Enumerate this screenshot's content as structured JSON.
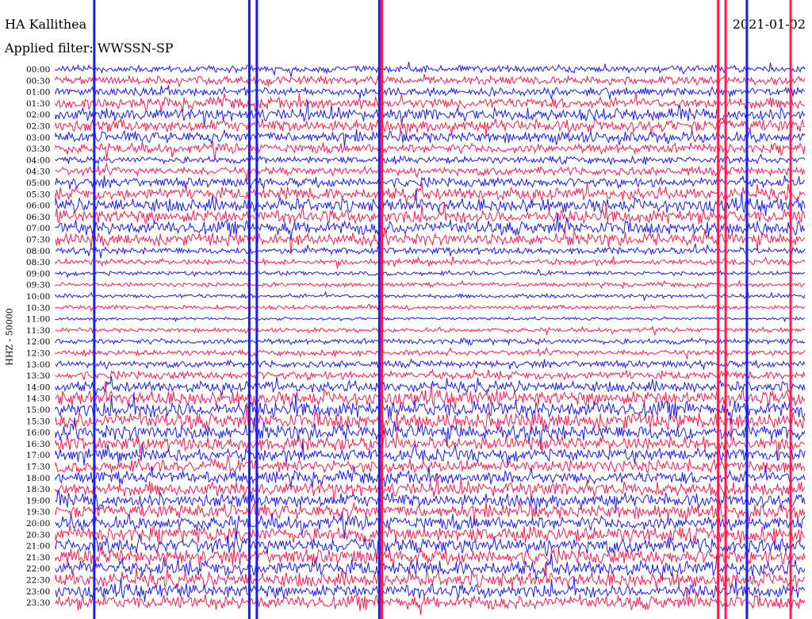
{
  "header": {
    "station": "HA Kallithea",
    "filter_label": "Applied filter: WWSSN-SP",
    "date": "2021-01-02"
  },
  "axis": {
    "ylabel": "HHZ - 50000"
  },
  "chart_data": {
    "type": "line",
    "title": "HA Kallithea",
    "subtitle": "Applied filter: WWSSN-SP",
    "date": "2021-01-02",
    "ylabel": "HHZ - 50000",
    "trace_colors": [
      "#1a1aff",
      "#ff1a4d"
    ],
    "x": {
      "unit": "minutes",
      "range": [
        0,
        30
      ]
    },
    "rows": [
      {
        "label": "00:00",
        "amp": 5
      },
      {
        "label": "00:30",
        "amp": 6
      },
      {
        "label": "01:00",
        "amp": 6
      },
      {
        "label": "01:30",
        "amp": 8
      },
      {
        "label": "02:00",
        "amp": 9
      },
      {
        "label": "02:30",
        "amp": 9
      },
      {
        "label": "03:00",
        "amp": 8
      },
      {
        "label": "03:30",
        "amp": 7
      },
      {
        "label": "04:00",
        "amp": 5
      },
      {
        "label": "04:30",
        "amp": 6
      },
      {
        "label": "05:00",
        "amp": 7
      },
      {
        "label": "05:30",
        "amp": 9
      },
      {
        "label": "06:00",
        "amp": 10
      },
      {
        "label": "06:30",
        "amp": 10
      },
      {
        "label": "07:00",
        "amp": 10
      },
      {
        "label": "07:30",
        "amp": 9
      },
      {
        "label": "08:00",
        "amp": 5
      },
      {
        "label": "08:30",
        "amp": 4
      },
      {
        "label": "09:00",
        "amp": 3
      },
      {
        "label": "09:30",
        "amp": 3
      },
      {
        "label": "10:00",
        "amp": 3
      },
      {
        "label": "10:30",
        "amp": 3
      },
      {
        "label": "11:00",
        "amp": 2
      },
      {
        "label": "11:30",
        "amp": 3
      },
      {
        "label": "12:00",
        "amp": 4
      },
      {
        "label": "12:30",
        "amp": 4
      },
      {
        "label": "13:00",
        "amp": 5
      },
      {
        "label": "13:30",
        "amp": 6
      },
      {
        "label": "14:00",
        "amp": 8
      },
      {
        "label": "14:30",
        "amp": 11
      },
      {
        "label": "15:00",
        "amp": 12
      },
      {
        "label": "15:30",
        "amp": 12
      },
      {
        "label": "16:00",
        "amp": 11
      },
      {
        "label": "16:30",
        "amp": 10
      },
      {
        "label": "17:00",
        "amp": 9
      },
      {
        "label": "17:30",
        "amp": 9
      },
      {
        "label": "18:00",
        "amp": 9
      },
      {
        "label": "18:30",
        "amp": 10
      },
      {
        "label": "19:00",
        "amp": 10
      },
      {
        "label": "19:30",
        "amp": 10
      },
      {
        "label": "20:00",
        "amp": 10
      },
      {
        "label": "20:30",
        "amp": 11
      },
      {
        "label": "21:00",
        "amp": 11
      },
      {
        "label": "21:30",
        "amp": 11
      },
      {
        "label": "22:00",
        "amp": 11
      },
      {
        "label": "22:30",
        "amp": 11
      },
      {
        "label": "23:00",
        "amp": 10
      },
      {
        "label": "23:30",
        "amp": 10
      }
    ],
    "spikes": [
      {
        "minute": 1.55,
        "row_start": 0,
        "row_end": 47,
        "color": "#1a1aff"
      },
      {
        "minute": 7.75,
        "row_start": 0,
        "row_end": 47,
        "color": "#1a1aff"
      },
      {
        "minute": 8.05,
        "row_start": 0,
        "row_end": 47,
        "color": "#1a1aff"
      },
      {
        "minute": 12.95,
        "row_start": 0,
        "row_end": 47,
        "color": "#1a1aff"
      },
      {
        "minute": 13.05,
        "row_start": 0,
        "row_end": 47,
        "color": "#ff1a4d"
      },
      {
        "minute": 26.5,
        "row_start": 0,
        "row_end": 47,
        "color": "#ff1a4d"
      },
      {
        "minute": 26.8,
        "row_start": 0,
        "row_end": 47,
        "color": "#ff1a4d"
      },
      {
        "minute": 27.65,
        "row_start": 0,
        "row_end": 47,
        "color": "#1a1aff"
      },
      {
        "minute": 29.4,
        "row_start": 0,
        "row_end": 47,
        "color": "#ff1a4d"
      }
    ]
  }
}
